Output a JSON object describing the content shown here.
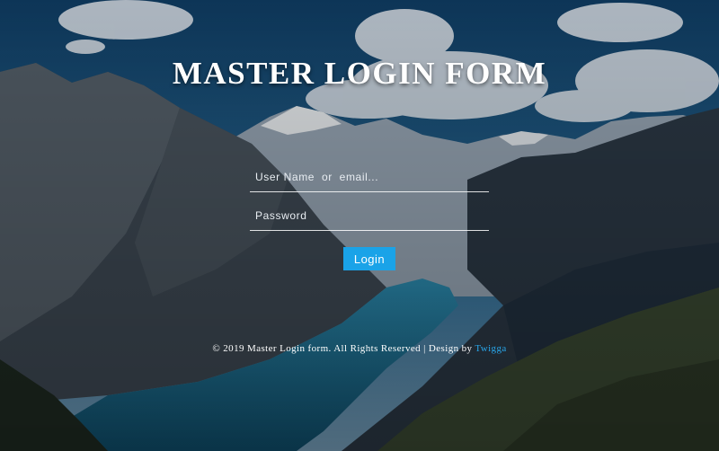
{
  "page": {
    "title": "MASTER LOGIN FORM"
  },
  "form": {
    "username_placeholder": "User Name  or  email...",
    "username_value": "",
    "password_placeholder": "Password",
    "password_value": "",
    "login_label": "Login"
  },
  "footer": {
    "copyright": "© 2019 Master Login form. All Rights Reserved | Design by ",
    "designer_link": "Twigga"
  },
  "colors": {
    "accent": "#1aa3e8",
    "link": "#29a8ec",
    "text": "#ffffff",
    "sky": "#1d5d8c",
    "lake": "#1f7a9e"
  },
  "background": {
    "icon": "mountain-lake-scene"
  }
}
